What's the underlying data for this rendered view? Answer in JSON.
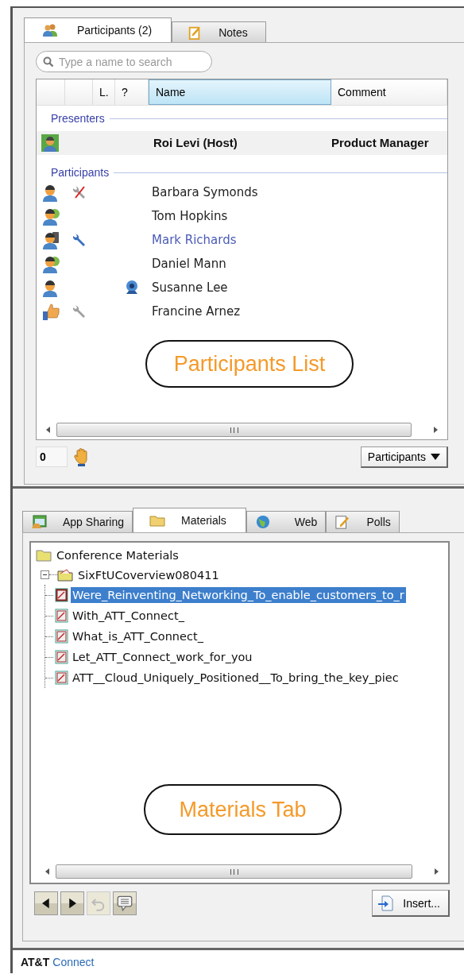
{
  "participants_panel": {
    "tabs": [
      {
        "label": "Participants (2)",
        "selected": true
      },
      {
        "label": "Notes",
        "selected": false
      }
    ],
    "search": {
      "placeholder": "Type a name to search"
    },
    "columns": [
      "L.",
      "?",
      "Name",
      "Comment"
    ],
    "groups": [
      {
        "title": "Presenters",
        "rows": [
          {
            "name": "Roi Levi (Host)",
            "comment": "Product Manager"
          }
        ]
      },
      {
        "title": "Participants",
        "rows": [
          {
            "name": "Barbara Symonds",
            "selected": false
          },
          {
            "name": "Tom Hopkins",
            "selected": false
          },
          {
            "name": "Mark Richards",
            "selected": true
          },
          {
            "name": "Daniel Mann",
            "selected": false
          },
          {
            "name": "Susanne Lee",
            "selected": false
          },
          {
            "name": "Francine Arnez",
            "selected": false
          }
        ]
      }
    ],
    "callout": "Participants List",
    "raised_hands": "0",
    "view_button": "Participants"
  },
  "materials_panel": {
    "tabs": [
      {
        "label": "App Sharing",
        "selected": false
      },
      {
        "label": "Materials",
        "selected": true
      },
      {
        "label": "Web",
        "selected": false
      },
      {
        "label": "Polls",
        "selected": false
      }
    ],
    "tree": {
      "label": "Conference Materials",
      "children": [
        {
          "label": "SixFtUCoverview080411",
          "expanded": true,
          "children": [
            {
              "label": "Were_Reinventing_Networking_To_enable_customers_to_r",
              "selected": true
            },
            {
              "label": "With_ATT_Connect_",
              "selected": false
            },
            {
              "label": "What_is_ATT_Connect_",
              "selected": false
            },
            {
              "label": "Let_ATT_Connect_work_for_you",
              "selected": false
            },
            {
              "label": "ATT__Cloud_Uniquely_Positioned__To_bring_the_key_piec",
              "selected": false
            }
          ]
        }
      ]
    },
    "callout": "Materials Tab",
    "toolbar": [
      {
        "kind": "back",
        "disabled": false
      },
      {
        "kind": "forward",
        "disabled": false
      },
      {
        "kind": "undo",
        "disabled": true
      },
      {
        "kind": "comment",
        "disabled": false
      }
    ],
    "insert_button": "Insert..."
  },
  "footer": {
    "brand": "AT&T",
    "product": "Connect"
  }
}
